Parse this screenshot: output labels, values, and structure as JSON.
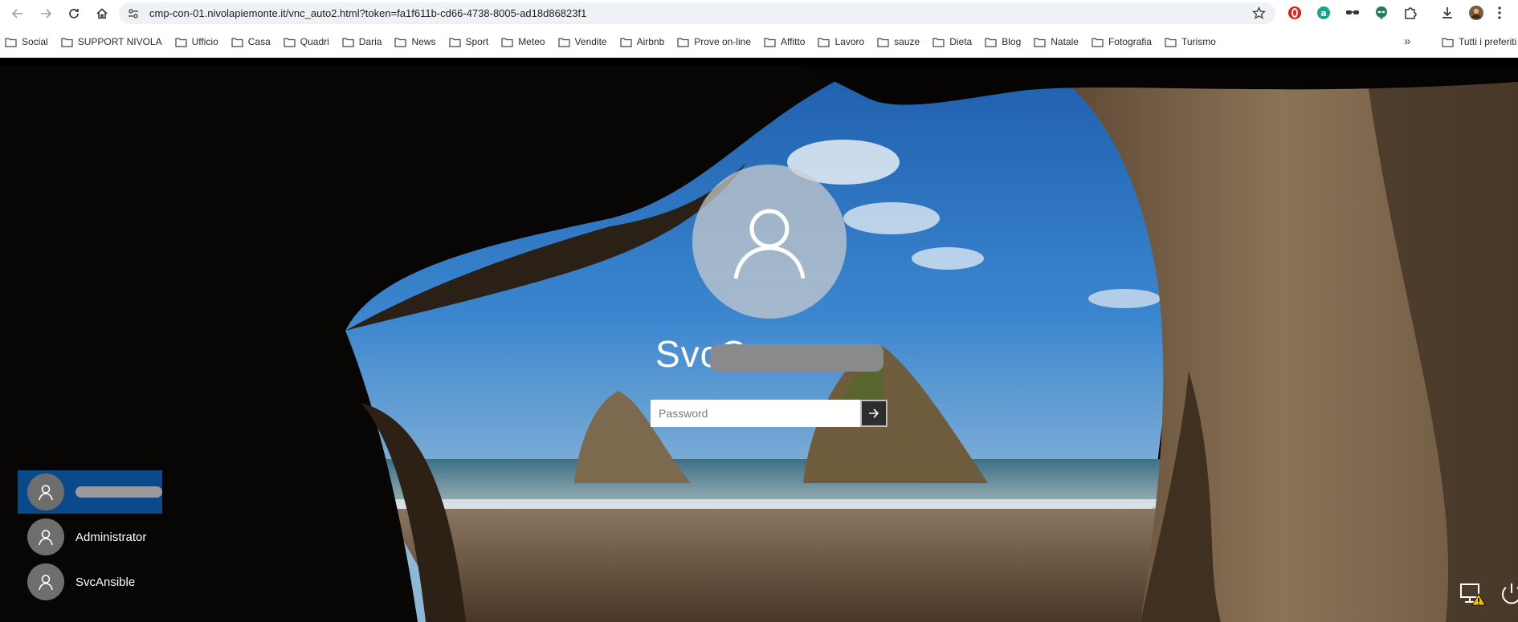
{
  "browser": {
    "url": "cmp-con-01.nivolapiemonte.it/vnc_auto2.html?token=fa1f611b-cd66-4738-8005-ad18d86823f1",
    "bookmarks": [
      "Social",
      "SUPPORT NIVOLA",
      "Ufficio",
      "Casa",
      "Quadri",
      "Daria",
      "News",
      "Sport",
      "Meteo",
      "Vendite",
      "Airbnb",
      "Prove on-line",
      "Affitto",
      "Lavoro",
      "sauze",
      "Dieta",
      "Blog",
      "Natale",
      "Fotografia",
      "Turismo"
    ],
    "more_label": "»",
    "all_bookmarks_label": "Tutti i preferiti"
  },
  "lock_screen": {
    "username_visible": "SvcC",
    "password_placeholder": "Password",
    "users": [
      {
        "name": "",
        "active": true,
        "redacted": true
      },
      {
        "name": "Administrator",
        "active": false,
        "redacted": false
      },
      {
        "name": "SvcAnsible",
        "active": false,
        "redacted": false
      }
    ]
  },
  "icons": {
    "back": "arrow-left-icon",
    "forward": "arrow-right-icon",
    "reload": "reload-icon",
    "home": "home-icon",
    "network": "network-warning-icon",
    "power": "power-icon"
  },
  "colors": {
    "selected_user": "#0a4a8c",
    "omnibox": "#eef1f6",
    "avatar_circle": "#cdcdcd"
  }
}
